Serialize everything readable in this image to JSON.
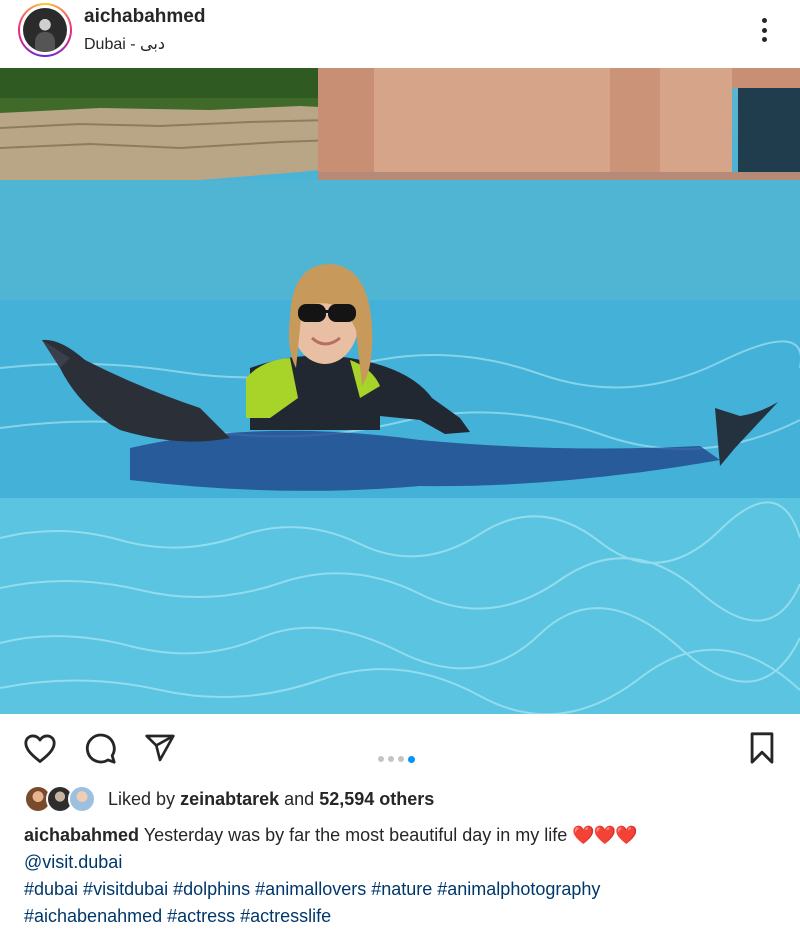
{
  "post": {
    "username": "aichabahmed",
    "location": "Dubai - دبی",
    "carousel": {
      "count": 4,
      "active_index": 3
    },
    "likes": {
      "prefix": "Liked by",
      "user": "zeinabtarek",
      "joiner": "and",
      "count_text": "52,594 others"
    },
    "caption": {
      "username": "aichabahmed",
      "text": "Yesterday was by far the most beautiful day in my life",
      "emoji": "❤️❤️❤️",
      "mention": "@visit.dubai",
      "hashtags_line1": "#dubai #visitdubai #dolphins #animallovers #nature #animalphotography",
      "hashtags_line2": "#aichabenahmed #actress #actresslife"
    }
  },
  "icons": {
    "more": "more-vertical-icon",
    "like": "heart-icon",
    "comment": "comment-icon",
    "share": "send-icon",
    "save": "bookmark-icon"
  },
  "colors": {
    "link": "#00376b",
    "accent": "#0095f6",
    "heart": "#e0212f",
    "text": "#262626"
  }
}
